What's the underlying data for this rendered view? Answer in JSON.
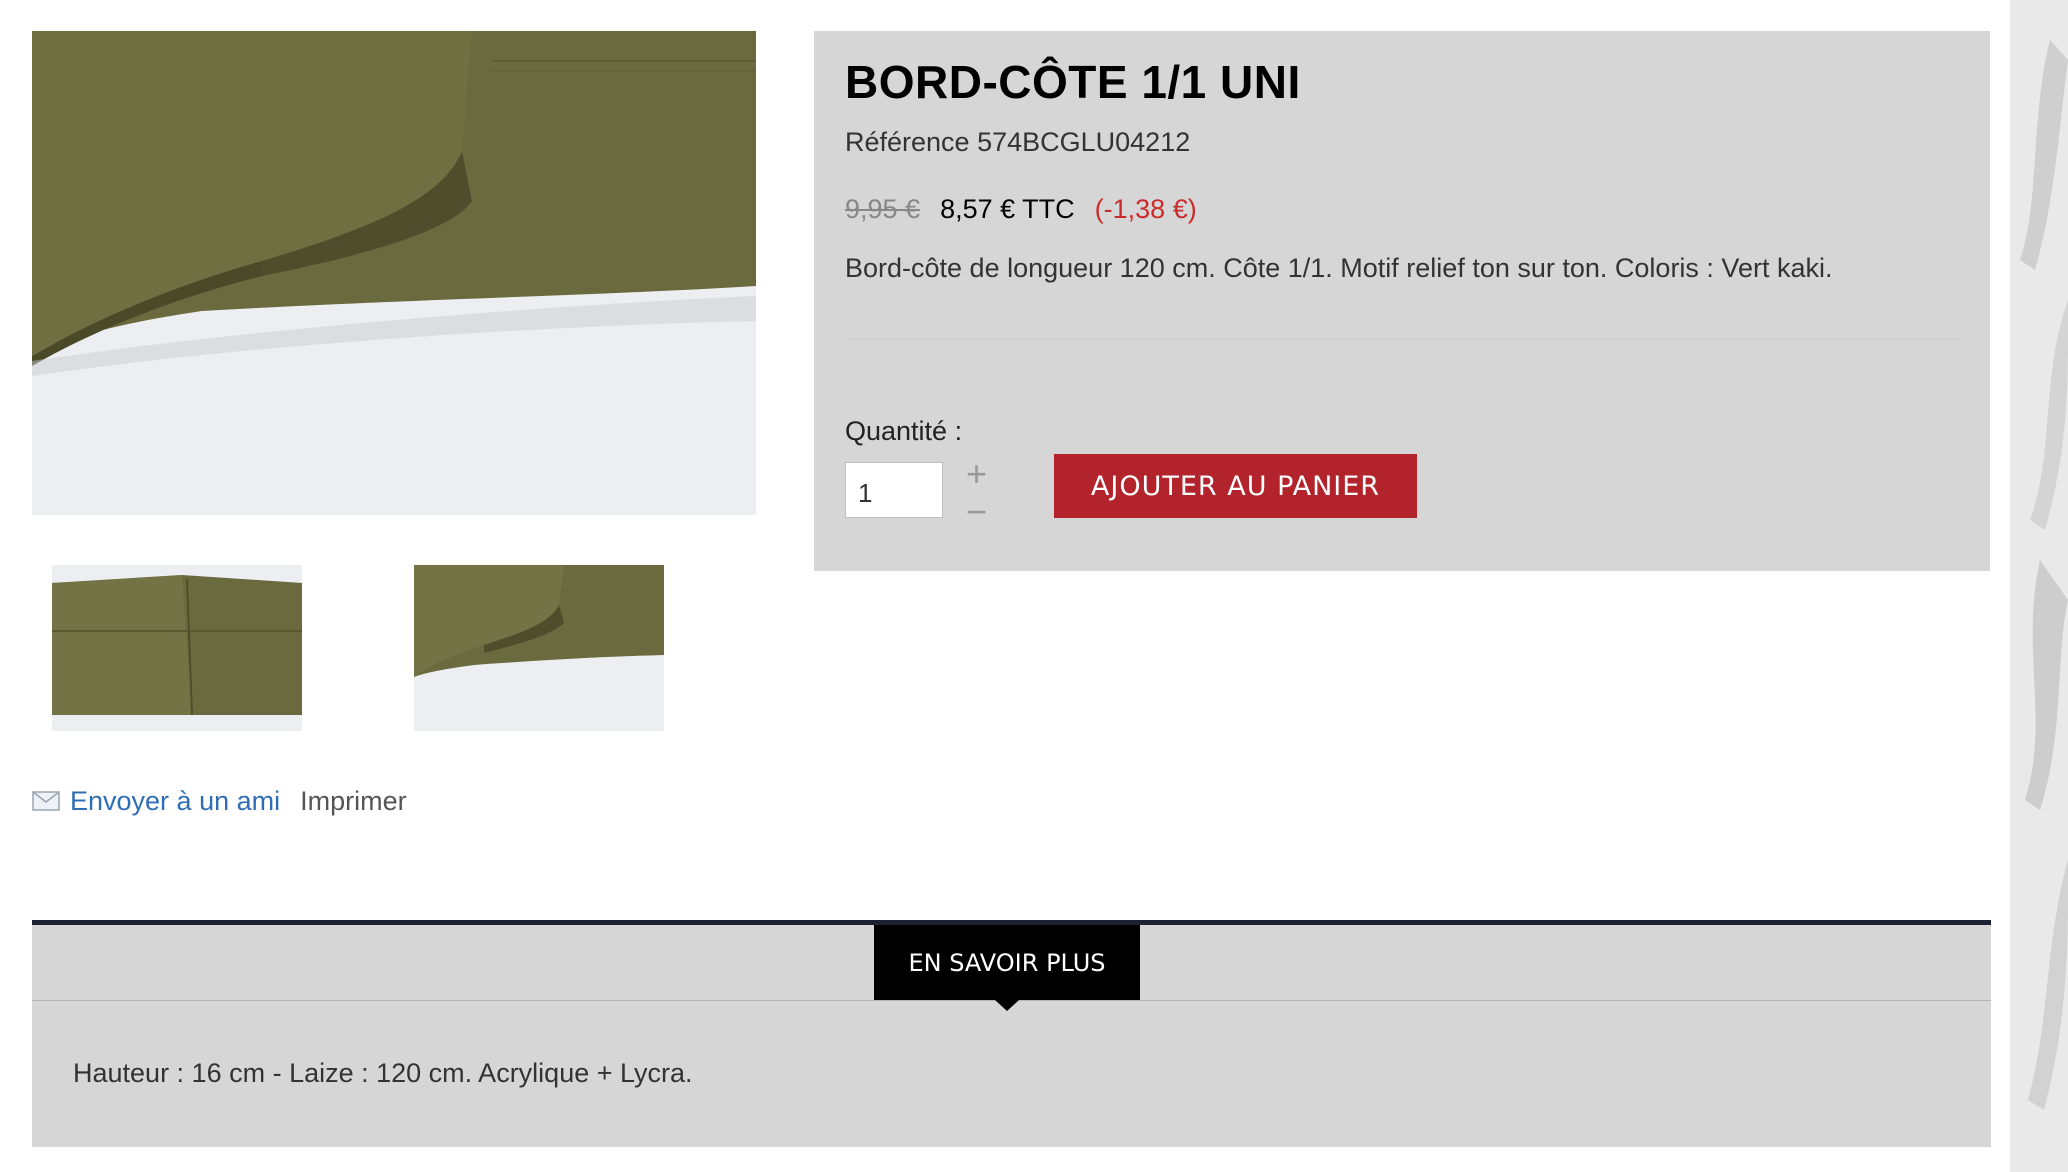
{
  "product": {
    "title": "BORD-CÔTE 1/1 UNI",
    "reference": "Référence 574BCGLU04212",
    "old_price": "9,95 €",
    "price": "8,57 € TTC",
    "discount": "(-1,38 €)",
    "description": "Bord-côte de longueur 120 cm. Côte 1/1. Motif relief ton sur ton. Coloris : Vert kaki.",
    "quantity_label": "Quantité :",
    "quantity_value": "1",
    "quantity_plus": "+",
    "quantity_minus": "−",
    "add_to_cart_label": "AJOUTER AU PANIER"
  },
  "actions": {
    "send_friend": "Envoyer à un ami",
    "print": "Imprimer"
  },
  "more_info": {
    "tab_label": "EN SAVOIR PLUS",
    "text": "Hauteur : 16 cm - Laize : 120 cm. Acrylique + Lycra."
  },
  "icons": {
    "mail": "envelope-icon"
  },
  "colors": {
    "khaki": "#6b6a3e",
    "add_to_cart_bg": "#b3232b",
    "discount": "#cc2b2b",
    "link": "#2f6db5",
    "panel_bg": "#d6d6d6",
    "tab_bg": "#000000"
  }
}
